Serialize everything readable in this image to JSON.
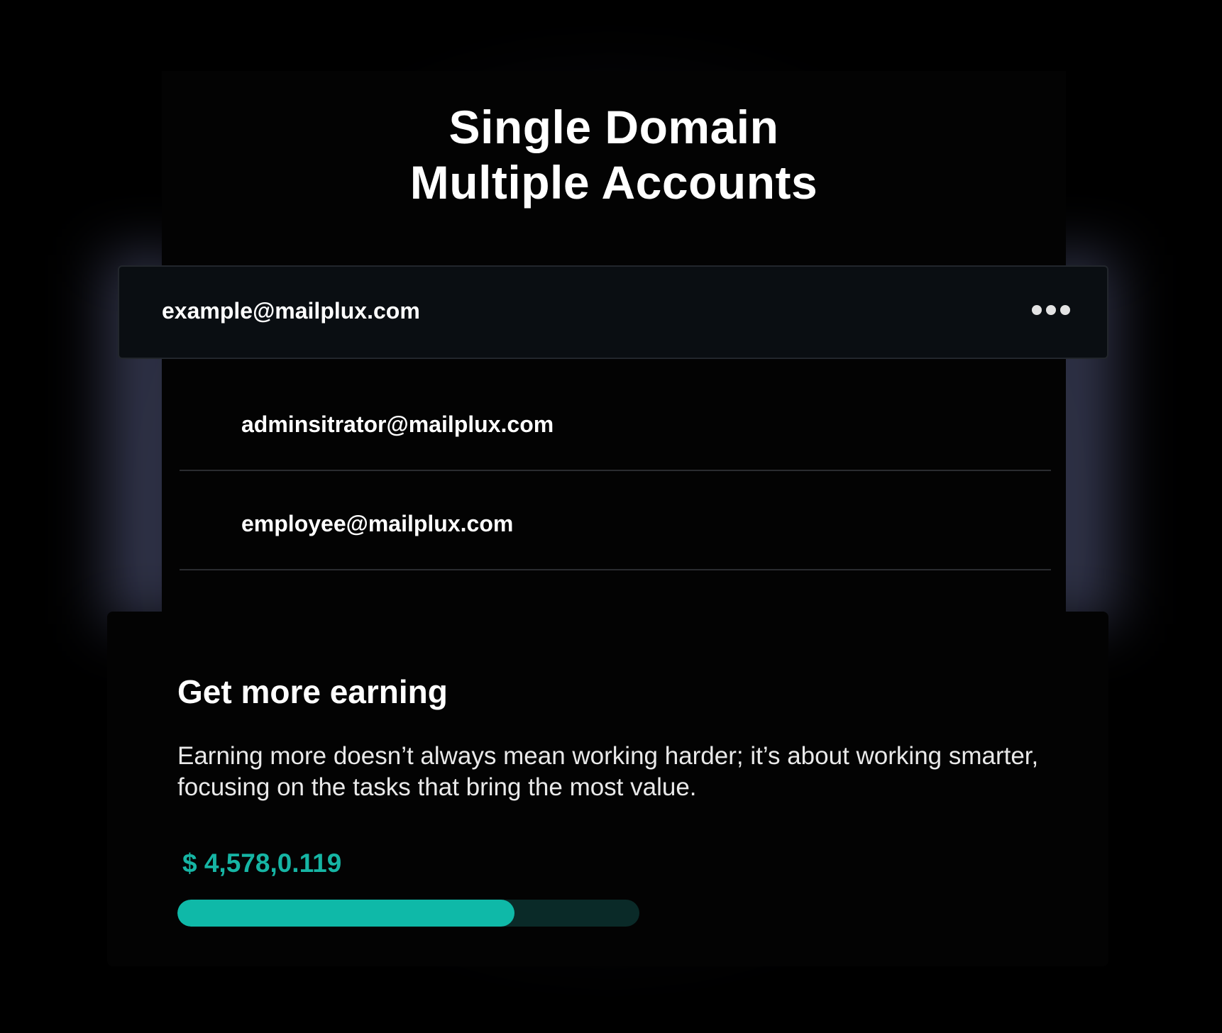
{
  "heading": {
    "line1": "Single Domain",
    "line2": "Multiple Accounts"
  },
  "accounts": {
    "selected": {
      "email": "example@mailplux.com",
      "menu_icon": "more-horizontal-icon"
    },
    "list": [
      {
        "email": "adminsitrator@mailplux.com"
      },
      {
        "email": "employee@mailplux.com"
      }
    ]
  },
  "earning": {
    "title": "Get more earning",
    "description": "Earning more doesn’t always mean working harder; it’s about working smarter, focusing on the tasks that bring the most value.",
    "amount": "$ 4,578,0.119",
    "progress": 0.73
  },
  "colors": {
    "accent": "#0fb9a8",
    "accent_text": "#16b5a4",
    "track": "#0a2a28",
    "card": "#0a0e12",
    "background": "#000000"
  }
}
